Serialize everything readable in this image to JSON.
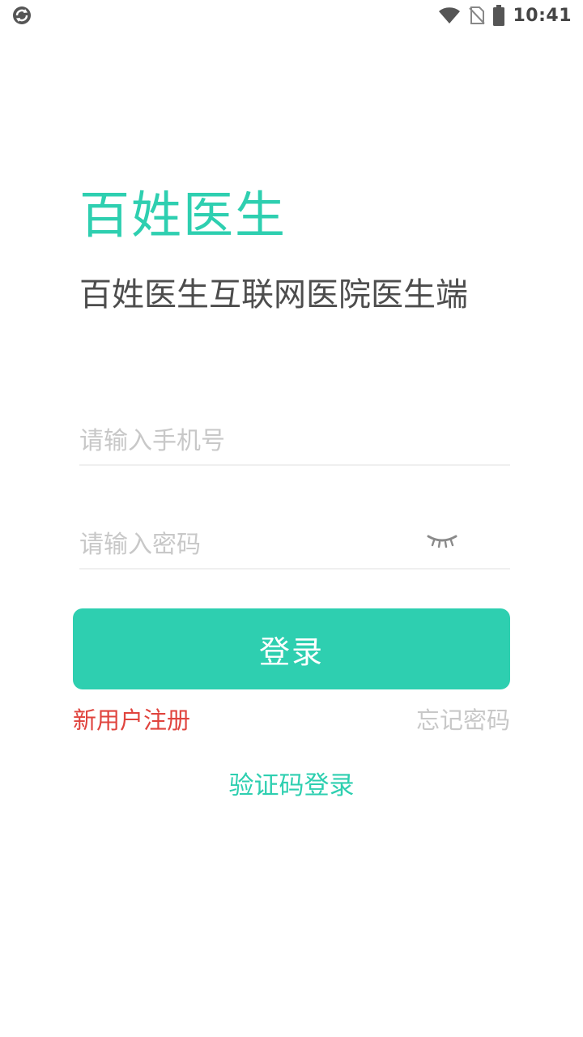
{
  "status_bar": {
    "time": "10:41",
    "left_icon": "sync-icon",
    "icons": [
      "wifi-icon",
      "no-sim-icon",
      "battery-icon"
    ]
  },
  "header": {
    "title": "百姓医生",
    "subtitle": "百姓医生互联网医院医生端"
  },
  "form": {
    "phone_placeholder": "请输入手机号",
    "phone_value": "",
    "password_placeholder": "请输入密码",
    "password_value": "",
    "password_toggle_icon": "eye-closed-icon",
    "login_label": "登录"
  },
  "links": {
    "register_label": "新用户注册",
    "forgot_label": "忘记密码",
    "sms_login_label": "验证码登录"
  },
  "colors": {
    "accent": "#2ecfb0",
    "register": "#e0443e",
    "muted": "#c8c8c8",
    "subtitle": "#4d4d4d"
  }
}
